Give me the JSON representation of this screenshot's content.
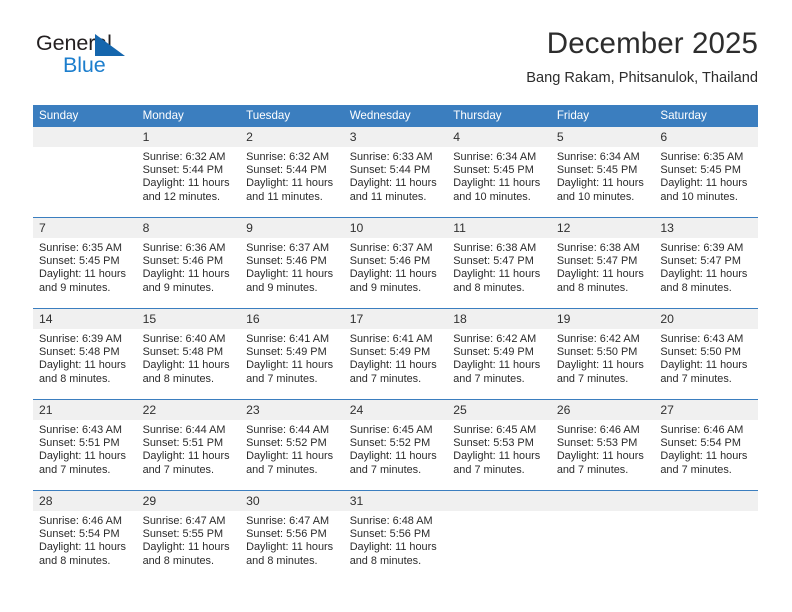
{
  "brand": {
    "name_part1": "General",
    "name_part2": "Blue",
    "logo_icon": "triangle-icon"
  },
  "header": {
    "month_title": "December 2025",
    "location": "Bang Rakam, Phitsanulok, Thailand"
  },
  "colors": {
    "header_blue": "#3b7ebf",
    "brand_blue": "#1c7ecd",
    "logo_triangle": "#1566ad",
    "daynum_bg": "#f0f0f0",
    "text": "#2b2b2b"
  },
  "weekdays": [
    "Sunday",
    "Monday",
    "Tuesday",
    "Wednesday",
    "Thursday",
    "Friday",
    "Saturday"
  ],
  "labels": {
    "sunrise_prefix": "Sunrise:",
    "sunset_prefix": "Sunset:",
    "daylight_prefix": "Daylight:"
  },
  "weeks": [
    [
      {
        "day": "",
        "empty": true
      },
      {
        "day": "1",
        "sunrise": "Sunrise: 6:32 AM",
        "sunset": "Sunset: 5:44 PM",
        "daylight_1": "Daylight: 11 hours",
        "daylight_2": "and 12 minutes."
      },
      {
        "day": "2",
        "sunrise": "Sunrise: 6:32 AM",
        "sunset": "Sunset: 5:44 PM",
        "daylight_1": "Daylight: 11 hours",
        "daylight_2": "and 11 minutes."
      },
      {
        "day": "3",
        "sunrise": "Sunrise: 6:33 AM",
        "sunset": "Sunset: 5:44 PM",
        "daylight_1": "Daylight: 11 hours",
        "daylight_2": "and 11 minutes."
      },
      {
        "day": "4",
        "sunrise": "Sunrise: 6:34 AM",
        "sunset": "Sunset: 5:45 PM",
        "daylight_1": "Daylight: 11 hours",
        "daylight_2": "and 10 minutes."
      },
      {
        "day": "5",
        "sunrise": "Sunrise: 6:34 AM",
        "sunset": "Sunset: 5:45 PM",
        "daylight_1": "Daylight: 11 hours",
        "daylight_2": "and 10 minutes."
      },
      {
        "day": "6",
        "sunrise": "Sunrise: 6:35 AM",
        "sunset": "Sunset: 5:45 PM",
        "daylight_1": "Daylight: 11 hours",
        "daylight_2": "and 10 minutes."
      }
    ],
    [
      {
        "day": "7",
        "sunrise": "Sunrise: 6:35 AM",
        "sunset": "Sunset: 5:45 PM",
        "daylight_1": "Daylight: 11 hours",
        "daylight_2": "and 9 minutes."
      },
      {
        "day": "8",
        "sunrise": "Sunrise: 6:36 AM",
        "sunset": "Sunset: 5:46 PM",
        "daylight_1": "Daylight: 11 hours",
        "daylight_2": "and 9 minutes."
      },
      {
        "day": "9",
        "sunrise": "Sunrise: 6:37 AM",
        "sunset": "Sunset: 5:46 PM",
        "daylight_1": "Daylight: 11 hours",
        "daylight_2": "and 9 minutes."
      },
      {
        "day": "10",
        "sunrise": "Sunrise: 6:37 AM",
        "sunset": "Sunset: 5:46 PM",
        "daylight_1": "Daylight: 11 hours",
        "daylight_2": "and 9 minutes."
      },
      {
        "day": "11",
        "sunrise": "Sunrise: 6:38 AM",
        "sunset": "Sunset: 5:47 PM",
        "daylight_1": "Daylight: 11 hours",
        "daylight_2": "and 8 minutes."
      },
      {
        "day": "12",
        "sunrise": "Sunrise: 6:38 AM",
        "sunset": "Sunset: 5:47 PM",
        "daylight_1": "Daylight: 11 hours",
        "daylight_2": "and 8 minutes."
      },
      {
        "day": "13",
        "sunrise": "Sunrise: 6:39 AM",
        "sunset": "Sunset: 5:47 PM",
        "daylight_1": "Daylight: 11 hours",
        "daylight_2": "and 8 minutes."
      }
    ],
    [
      {
        "day": "14",
        "sunrise": "Sunrise: 6:39 AM",
        "sunset": "Sunset: 5:48 PM",
        "daylight_1": "Daylight: 11 hours",
        "daylight_2": "and 8 minutes."
      },
      {
        "day": "15",
        "sunrise": "Sunrise: 6:40 AM",
        "sunset": "Sunset: 5:48 PM",
        "daylight_1": "Daylight: 11 hours",
        "daylight_2": "and 8 minutes."
      },
      {
        "day": "16",
        "sunrise": "Sunrise: 6:41 AM",
        "sunset": "Sunset: 5:49 PM",
        "daylight_1": "Daylight: 11 hours",
        "daylight_2": "and 7 minutes."
      },
      {
        "day": "17",
        "sunrise": "Sunrise: 6:41 AM",
        "sunset": "Sunset: 5:49 PM",
        "daylight_1": "Daylight: 11 hours",
        "daylight_2": "and 7 minutes."
      },
      {
        "day": "18",
        "sunrise": "Sunrise: 6:42 AM",
        "sunset": "Sunset: 5:49 PM",
        "daylight_1": "Daylight: 11 hours",
        "daylight_2": "and 7 minutes."
      },
      {
        "day": "19",
        "sunrise": "Sunrise: 6:42 AM",
        "sunset": "Sunset: 5:50 PM",
        "daylight_1": "Daylight: 11 hours",
        "daylight_2": "and 7 minutes."
      },
      {
        "day": "20",
        "sunrise": "Sunrise: 6:43 AM",
        "sunset": "Sunset: 5:50 PM",
        "daylight_1": "Daylight: 11 hours",
        "daylight_2": "and 7 minutes."
      }
    ],
    [
      {
        "day": "21",
        "sunrise": "Sunrise: 6:43 AM",
        "sunset": "Sunset: 5:51 PM",
        "daylight_1": "Daylight: 11 hours",
        "daylight_2": "and 7 minutes."
      },
      {
        "day": "22",
        "sunrise": "Sunrise: 6:44 AM",
        "sunset": "Sunset: 5:51 PM",
        "daylight_1": "Daylight: 11 hours",
        "daylight_2": "and 7 minutes."
      },
      {
        "day": "23",
        "sunrise": "Sunrise: 6:44 AM",
        "sunset": "Sunset: 5:52 PM",
        "daylight_1": "Daylight: 11 hours",
        "daylight_2": "and 7 minutes."
      },
      {
        "day": "24",
        "sunrise": "Sunrise: 6:45 AM",
        "sunset": "Sunset: 5:52 PM",
        "daylight_1": "Daylight: 11 hours",
        "daylight_2": "and 7 minutes."
      },
      {
        "day": "25",
        "sunrise": "Sunrise: 6:45 AM",
        "sunset": "Sunset: 5:53 PM",
        "daylight_1": "Daylight: 11 hours",
        "daylight_2": "and 7 minutes."
      },
      {
        "day": "26",
        "sunrise": "Sunrise: 6:46 AM",
        "sunset": "Sunset: 5:53 PM",
        "daylight_1": "Daylight: 11 hours",
        "daylight_2": "and 7 minutes."
      },
      {
        "day": "27",
        "sunrise": "Sunrise: 6:46 AM",
        "sunset": "Sunset: 5:54 PM",
        "daylight_1": "Daylight: 11 hours",
        "daylight_2": "and 7 minutes."
      }
    ],
    [
      {
        "day": "28",
        "sunrise": "Sunrise: 6:46 AM",
        "sunset": "Sunset: 5:54 PM",
        "daylight_1": "Daylight: 11 hours",
        "daylight_2": "and 8 minutes."
      },
      {
        "day": "29",
        "sunrise": "Sunrise: 6:47 AM",
        "sunset": "Sunset: 5:55 PM",
        "daylight_1": "Daylight: 11 hours",
        "daylight_2": "and 8 minutes."
      },
      {
        "day": "30",
        "sunrise": "Sunrise: 6:47 AM",
        "sunset": "Sunset: 5:56 PM",
        "daylight_1": "Daylight: 11 hours",
        "daylight_2": "and 8 minutes."
      },
      {
        "day": "31",
        "sunrise": "Sunrise: 6:48 AM",
        "sunset": "Sunset: 5:56 PM",
        "daylight_1": "Daylight: 11 hours",
        "daylight_2": "and 8 minutes."
      },
      {
        "day": "",
        "empty": true
      },
      {
        "day": "",
        "empty": true
      },
      {
        "day": "",
        "empty": true
      }
    ]
  ]
}
